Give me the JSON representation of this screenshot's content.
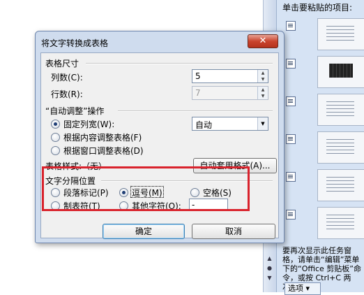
{
  "task_pane": {
    "title": "单击要粘贴的项目:",
    "footer_text": "要再次显示此任务窗格，请单击“编辑”菜单下的“Office 剪贴板”命令，或按 Ctrl+C 两次。",
    "options_label": "选项 ▾"
  },
  "dialog": {
    "title": "将文字转换成表格",
    "close_label": "✕",
    "table_size": {
      "section_label": "表格尺寸",
      "columns_label": "列数(C):",
      "columns_value": "5",
      "rows_label": "行数(R):",
      "rows_value": "7"
    },
    "autofit": {
      "section_label": "“自动调整”操作",
      "options": [
        {
          "label": "固定列宽(W):",
          "selected": true
        },
        {
          "label": "根据内容调整表格(F)",
          "selected": false
        },
        {
          "label": "根据窗口调整表格(D)",
          "selected": false
        }
      ],
      "fixed_width_value": "自动"
    },
    "table_style": {
      "label": "表格样式:（无）",
      "autoformat_button": "自动套用格式(A)..."
    },
    "separator": {
      "section_label": "文字分隔位置",
      "options": [
        {
          "label": "段落标记(P)",
          "selected": false
        },
        {
          "label": "逗号(M)",
          "selected": true
        },
        {
          "label": "空格(S)",
          "selected": false
        },
        {
          "label": "制表符(T)",
          "selected": false
        },
        {
          "label": "其他字符(O):",
          "selected": false
        }
      ],
      "other_char_value": "-"
    },
    "ok_button": "确定",
    "cancel_button": "取消"
  }
}
